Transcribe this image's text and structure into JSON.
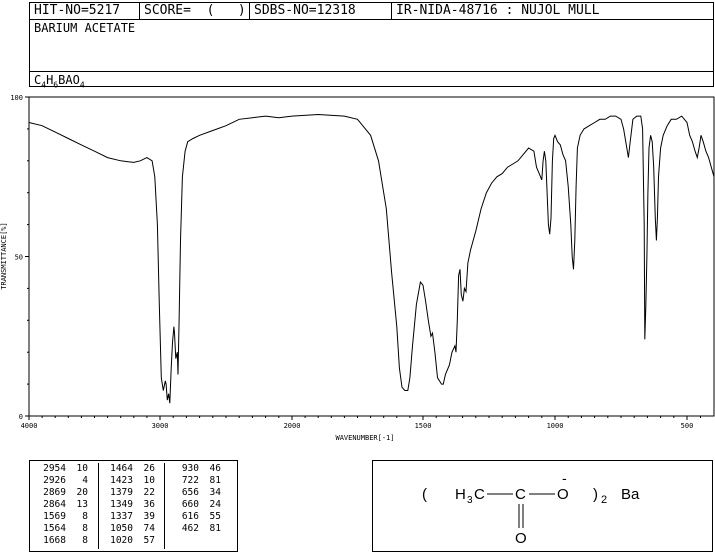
{
  "header": {
    "hit_no": "HIT-NO=5217",
    "score": "SCORE=  (   )",
    "sdbs_no": "SDBS-NO=12318",
    "method": "IR-NIDA-48716 : NUJOL MULL",
    "compound_name": "BARIUM ACETATE",
    "formula_parts": [
      {
        "t": "C",
        "sub": "4"
      },
      {
        "t": "H",
        "sub": "6"
      },
      {
        "t": "BAO",
        "sub": "4"
      }
    ]
  },
  "chart_data": {
    "type": "line",
    "xlabel": "WAVENUMBER[-1]",
    "ylabel": "TRANSMITTANCE[%]",
    "xlim": [
      4000,
      400
    ],
    "ylim": [
      0,
      100
    ],
    "x_ticks": [
      "4000",
      "3000",
      "2000",
      "1500",
      "1000",
      "500"
    ],
    "y_ticks": [
      "0",
      "50",
      "100"
    ],
    "series": [
      {
        "points": [
          [
            4000,
            92
          ],
          [
            3900,
            91
          ],
          [
            3800,
            89
          ],
          [
            3700,
            87
          ],
          [
            3600,
            85
          ],
          [
            3500,
            83
          ],
          [
            3400,
            81
          ],
          [
            3300,
            80
          ],
          [
            3200,
            79.5
          ],
          [
            3150,
            80
          ],
          [
            3100,
            81
          ],
          [
            3060,
            80
          ],
          [
            3040,
            75
          ],
          [
            3020,
            60
          ],
          [
            3005,
            35
          ],
          [
            2990,
            12
          ],
          [
            2975,
            8
          ],
          [
            2960,
            11
          ],
          [
            2954,
            10
          ],
          [
            2945,
            5
          ],
          [
            2935,
            7
          ],
          [
            2926,
            4
          ],
          [
            2915,
            15
          ],
          [
            2905,
            23
          ],
          [
            2895,
            28
          ],
          [
            2890,
            26
          ],
          [
            2880,
            18
          ],
          [
            2869,
            20
          ],
          [
            2864,
            13
          ],
          [
            2855,
            30
          ],
          [
            2845,
            55
          ],
          [
            2830,
            75
          ],
          [
            2810,
            83
          ],
          [
            2790,
            86
          ],
          [
            2750,
            87
          ],
          [
            2700,
            88
          ],
          [
            2600,
            89.5
          ],
          [
            2500,
            91
          ],
          [
            2400,
            93
          ],
          [
            2300,
            93.5
          ],
          [
            2200,
            94
          ],
          [
            2100,
            93.5
          ],
          [
            2000,
            94
          ],
          [
            1900,
            94.5
          ],
          [
            1800,
            94
          ],
          [
            1750,
            93
          ],
          [
            1700,
            88
          ],
          [
            1670,
            80
          ],
          [
            1640,
            65
          ],
          [
            1620,
            45
          ],
          [
            1600,
            28
          ],
          [
            1590,
            15
          ],
          [
            1580,
            9
          ],
          [
            1569,
            8
          ],
          [
            1564,
            8
          ],
          [
            1558,
            8
          ],
          [
            1550,
            12
          ],
          [
            1540,
            22
          ],
          [
            1525,
            35
          ],
          [
            1510,
            42
          ],
          [
            1500,
            41
          ],
          [
            1490,
            36
          ],
          [
            1480,
            30
          ],
          [
            1470,
            25
          ],
          [
            1464,
            26
          ],
          [
            1455,
            20
          ],
          [
            1445,
            12
          ],
          [
            1430,
            10
          ],
          [
            1423,
            10
          ],
          [
            1415,
            13
          ],
          [
            1400,
            16
          ],
          [
            1390,
            20
          ],
          [
            1379,
            22
          ],
          [
            1375,
            20
          ],
          [
            1370,
            30
          ],
          [
            1365,
            44
          ],
          [
            1360,
            46
          ],
          [
            1355,
            38
          ],
          [
            1349,
            36
          ],
          [
            1343,
            40
          ],
          [
            1337,
            39
          ],
          [
            1330,
            48
          ],
          [
            1320,
            52
          ],
          [
            1300,
            58
          ],
          [
            1280,
            65
          ],
          [
            1260,
            70
          ],
          [
            1240,
            73
          ],
          [
            1220,
            75
          ],
          [
            1200,
            76
          ],
          [
            1180,
            78
          ],
          [
            1160,
            79
          ],
          [
            1140,
            80
          ],
          [
            1120,
            82
          ],
          [
            1100,
            84
          ],
          [
            1080,
            83
          ],
          [
            1070,
            78
          ],
          [
            1060,
            76
          ],
          [
            1050,
            74
          ],
          [
            1045,
            80
          ],
          [
            1040,
            83
          ],
          [
            1035,
            80
          ],
          [
            1030,
            70
          ],
          [
            1025,
            60
          ],
          [
            1020,
            57
          ],
          [
            1015,
            62
          ],
          [
            1010,
            80
          ],
          [
            1005,
            87
          ],
          [
            1000,
            88
          ],
          [
            990,
            86
          ],
          [
            980,
            85
          ],
          [
            970,
            82
          ],
          [
            960,
            80
          ],
          [
            950,
            72
          ],
          [
            940,
            60
          ],
          [
            935,
            50
          ],
          [
            930,
            46
          ],
          [
            925,
            55
          ],
          [
            920,
            72
          ],
          [
            915,
            84
          ],
          [
            905,
            88
          ],
          [
            890,
            90
          ],
          [
            870,
            91
          ],
          [
            850,
            92
          ],
          [
            830,
            93
          ],
          [
            810,
            93
          ],
          [
            790,
            94
          ],
          [
            770,
            94
          ],
          [
            750,
            93
          ],
          [
            740,
            90
          ],
          [
            730,
            85
          ],
          [
            722,
            81
          ],
          [
            715,
            86
          ],
          [
            705,
            93
          ],
          [
            690,
            94
          ],
          [
            675,
            94
          ],
          [
            668,
            90
          ],
          [
            662,
            60
          ],
          [
            660,
            24
          ],
          [
            656,
            34
          ],
          [
            652,
            50
          ],
          [
            648,
            70
          ],
          [
            644,
            84
          ],
          [
            638,
            88
          ],
          [
            632,
            86
          ],
          [
            626,
            78
          ],
          [
            620,
            62
          ],
          [
            616,
            55
          ],
          [
            612,
            62
          ],
          [
            608,
            75
          ],
          [
            600,
            84
          ],
          [
            590,
            88
          ],
          [
            575,
            91
          ],
          [
            560,
            93
          ],
          [
            540,
            93
          ],
          [
            520,
            94
          ],
          [
            500,
            92
          ],
          [
            490,
            88
          ],
          [
            480,
            86
          ],
          [
            470,
            83
          ],
          [
            462,
            81
          ],
          [
            455,
            84
          ],
          [
            448,
            88
          ],
          [
            440,
            86
          ],
          [
            430,
            83
          ],
          [
            420,
            81
          ],
          [
            410,
            78
          ],
          [
            400,
            75
          ]
        ]
      }
    ]
  },
  "peak_table": {
    "columns": [
      [
        [
          "2954",
          "10"
        ],
        [
          "2926",
          "4"
        ],
        [
          "2869",
          "20"
        ],
        [
          "2864",
          "13"
        ],
        [
          "1569",
          "8"
        ],
        [
          "1564",
          "8"
        ],
        [
          "1668",
          "8"
        ]
      ],
      [
        [
          "1464",
          "26"
        ],
        [
          "1423",
          "10"
        ],
        [
          "1379",
          "22"
        ],
        [
          "1349",
          "36"
        ],
        [
          "1337",
          "39"
        ],
        [
          "1050",
          "74"
        ],
        [
          "1020",
          "57"
        ]
      ],
      [
        [
          "930",
          "46"
        ],
        [
          "722",
          "81"
        ],
        [
          "656",
          "34"
        ],
        [
          "660",
          "24"
        ],
        [
          "616",
          "55"
        ],
        [
          "462",
          "81"
        ]
      ]
    ]
  },
  "structure": {
    "open_paren": "(",
    "h3c": "H",
    "h3c_sub": "3",
    "h3c_c": "C",
    "carbon": "C",
    "oxygen_single": "O",
    "charge": "-",
    "oxygen_double": "O",
    "close_paren": ")",
    "multiplier": "2",
    "cation": "Ba"
  }
}
